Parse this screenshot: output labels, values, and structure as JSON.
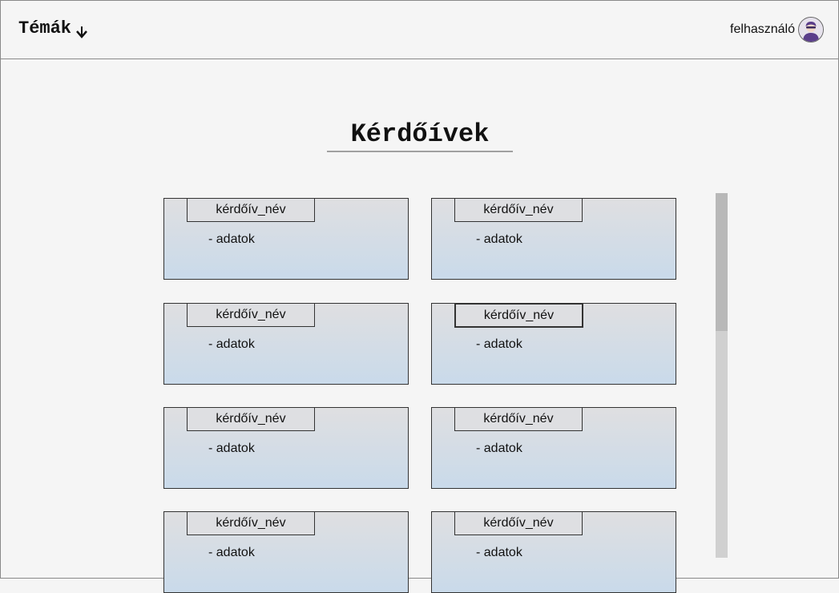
{
  "header": {
    "topics_label": "Témák",
    "username": "felhasználó"
  },
  "page": {
    "title": "Kérdőívek"
  },
  "cards": [
    {
      "name": "kérdőív_név",
      "data": "- adatok"
    },
    {
      "name": "kérdőív_név",
      "data": "- adatok"
    },
    {
      "name": "kérdőív_név",
      "data": "- adatok"
    },
    {
      "name": "kérdőív_név",
      "data": "- adatok"
    },
    {
      "name": "kérdőív_név",
      "data": "- adatok"
    },
    {
      "name": "kérdőív_név",
      "data": "- adatok"
    },
    {
      "name": "kérdőív_név",
      "data": "- adatok"
    },
    {
      "name": "kérdőív_név",
      "data": "- adatok"
    }
  ],
  "icons": {
    "topics_dropdown": "chevron-down-icon",
    "avatar": "user-avatar-icon"
  },
  "colors": {
    "background": "#f5f5f5",
    "card_top": "#dfdfe1",
    "card_bottom": "#c9daea",
    "avatar_figure": "#5a3d8a"
  }
}
